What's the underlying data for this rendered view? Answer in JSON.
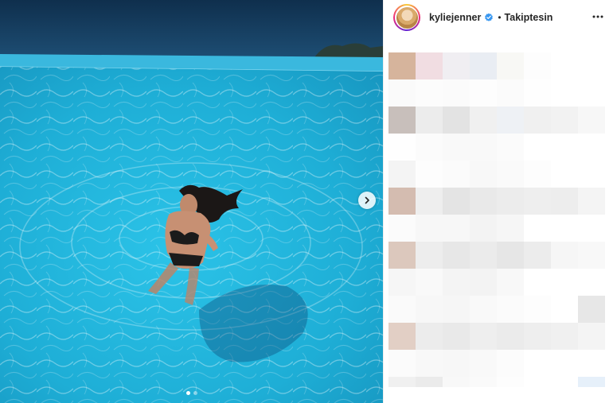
{
  "post": {
    "author": {
      "username": "kyliejenner",
      "verified": true,
      "separator": "•",
      "follow_status": "Takiptesin",
      "avatar_icon": "avatar-photo"
    },
    "media": {
      "carousel_slides": 2,
      "active_slide": 1,
      "next_icon": "chevron-right-icon"
    },
    "menu_icon": "more-horizontal-icon",
    "colors": {
      "pool_water": "#1ea9d1",
      "sea": "#123a5c",
      "pool_edge": "#3ab8de",
      "verified_blue": "#3897f0"
    }
  }
}
